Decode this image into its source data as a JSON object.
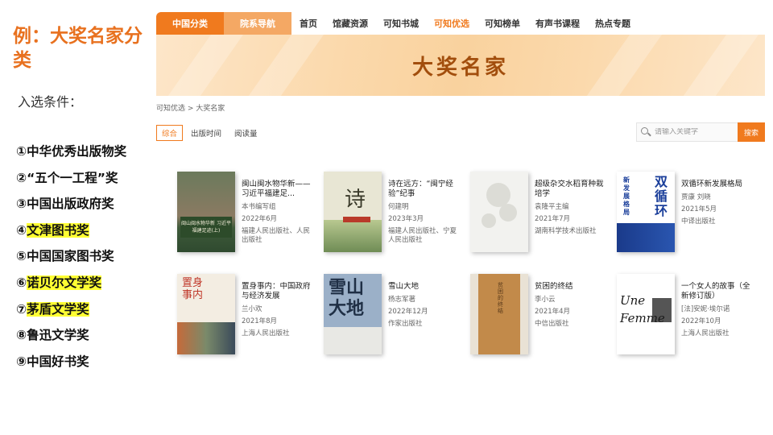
{
  "slide": {
    "title": "例：大奖名家分类",
    "subtitle": "入选条件：",
    "awards": [
      {
        "num": "①",
        "text": "中华优秀出版物奖",
        "highlight": false
      },
      {
        "num": "②",
        "text": "“五个一工程”奖",
        "highlight": false
      },
      {
        "num": "③",
        "text": "中国出版政府奖",
        "highlight": false
      },
      {
        "num": "④",
        "text": "文津图书奖",
        "highlight": true
      },
      {
        "num": "⑤",
        "text": "中国国家图书奖",
        "highlight": false
      },
      {
        "num": "⑥",
        "text": "诺贝尔文学奖",
        "highlight": true
      },
      {
        "num": "⑦",
        "text": "茅盾文学奖",
        "highlight": true
      },
      {
        "num": "⑧",
        "text": "鲁迅文学奖",
        "highlight": false
      },
      {
        "num": "⑨",
        "text": "中国好书奖",
        "highlight": false
      }
    ]
  },
  "site": {
    "nav": {
      "tab_class": "中国分类",
      "tab_college": "院系导航",
      "links": [
        "首页",
        "馆藏资源",
        "可知书城",
        "可知优选",
        "可知榜单",
        "有声书课程",
        "热点专题"
      ],
      "active_index": 3
    },
    "banner_title": "大奖名家",
    "breadcrumb": "可知优选 > 大奖名家",
    "sort": [
      "综合",
      "出版时间",
      "阅读量"
    ],
    "search": {
      "placeholder": "请输入关键字",
      "button": "搜索"
    },
    "books": [
      {
        "title": "闽山闽水物华新——习近平福建足...",
        "author": "本书编写组",
        "date": "2022年6月",
        "publisher": "福建人民出版社、人民出版社",
        "cover_text": "闽山闽水物华新 习近平福建足迹(上)"
      },
      {
        "title": "诗在远方：“闽宁经验”纪事",
        "author": "何建明",
        "date": "2023年3月",
        "publisher": "福建人民出版社、宁夏人民出版社",
        "cover_text": "诗"
      },
      {
        "title": "超级杂交水稻育种栽培学",
        "author": "袁隆平主编",
        "date": "2021年7月",
        "publisher": "湖南科学技术出版社",
        "cover_text": ""
      },
      {
        "title": "双循环新发展格局",
        "author": "贾康 刘晓",
        "date": "2021年5月",
        "publisher": "中译出版社",
        "cover_text": "双循环"
      },
      {
        "title": "置身事内：中国政府与经济发展",
        "author": "兰小欢",
        "date": "2021年8月",
        "publisher": "上海人民出版社",
        "cover_text": "置身事内"
      },
      {
        "title": "雪山大地",
        "author": "杨志军著",
        "date": "2022年12月",
        "publisher": "作家出版社",
        "cover_text": "雪山大地"
      },
      {
        "title": "贫困的终结",
        "author": "李小云",
        "date": "2021年4月",
        "publisher": "中信出版社",
        "cover_text": "贫困的终结"
      },
      {
        "title": "一个女人的故事（全新修订版）",
        "author": "[法]安妮·埃尔诺",
        "date": "2022年10月",
        "publisher": "上海人民出版社",
        "cover_text": "Une Femme"
      }
    ]
  },
  "colors": {
    "accent": "#f07a1e",
    "title_orange": "#e8711f",
    "highlight": "#ffff33"
  }
}
